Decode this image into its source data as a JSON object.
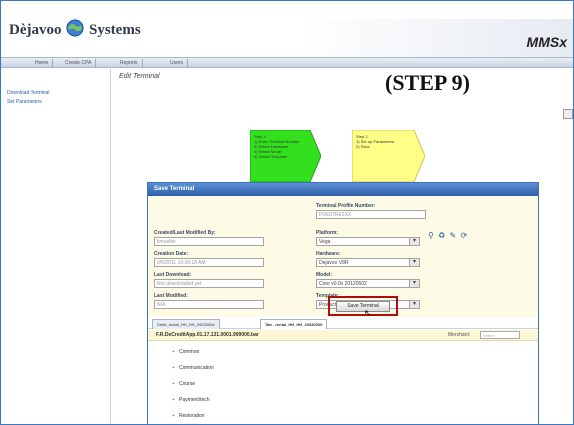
{
  "header": {
    "logo_left": "Dèjavoo",
    "logo_right": "Systems",
    "brand": "MMSx"
  },
  "nav": {
    "items": [
      "Home",
      "Create CPA",
      "Reports",
      "Users"
    ]
  },
  "sidebar": {
    "links": [
      "Download Terminal",
      "Set Parameters"
    ]
  },
  "main": {
    "crumb": "Edit Terminal",
    "step_title": "(STEP 9)",
    "wizard": {
      "step1": [
        "Step 1",
        "1) Enter Terminal Number",
        "2) Select Hardware",
        "3) Select Model",
        "4) Select Template"
      ],
      "step2": [
        "Step 2",
        "1) Set up Parameters",
        "2) Save"
      ]
    },
    "panel": {
      "title": "Save Terminal",
      "terminal_number_label": "Terminal Profile Number:",
      "terminal_number_value": "PDE07RE2XX",
      "created_label": "Created/Last Modified By:",
      "created_value": "kmueller",
      "creation_date_label": "Creation Date:",
      "creation_date_value": "9/6/2011 10:30:18 AM",
      "last_download_label": "Last Download:",
      "last_download_value": "Not downloaded yet",
      "last_modified_label": "Last Modified:",
      "last_modified_value": "N/A",
      "platform_label": "Platform:",
      "platform_value": "Vega",
      "hardware_label": "Hardware:",
      "hardware_value": "Dejavoo V8R",
      "model_label": "Model:",
      "model_value": "Core v0.0x 20120502",
      "template_label": "Template:",
      "template_value": "Production-Mon 20120502",
      "save_button": "Save Terminal"
    },
    "tabs": [
      "Debit_rental_HH_HH_20030004",
      "Tab - rental_HH_HH_20030005"
    ],
    "file_name": "F.R.DeCreditApp.01.17.131.0001.999000.bar",
    "merchant_label": "Merchant:",
    "merchant_value": "Select",
    "tree": [
      "Common",
      "Communication",
      "Course",
      "Payment/tech",
      "Restoration"
    ]
  },
  "colors": {
    "accent_blue": "#2f5ea6",
    "wizard_green": "#33e01e",
    "wizard_yellow": "#ffff88",
    "highlight_red": "#b00d0d"
  }
}
